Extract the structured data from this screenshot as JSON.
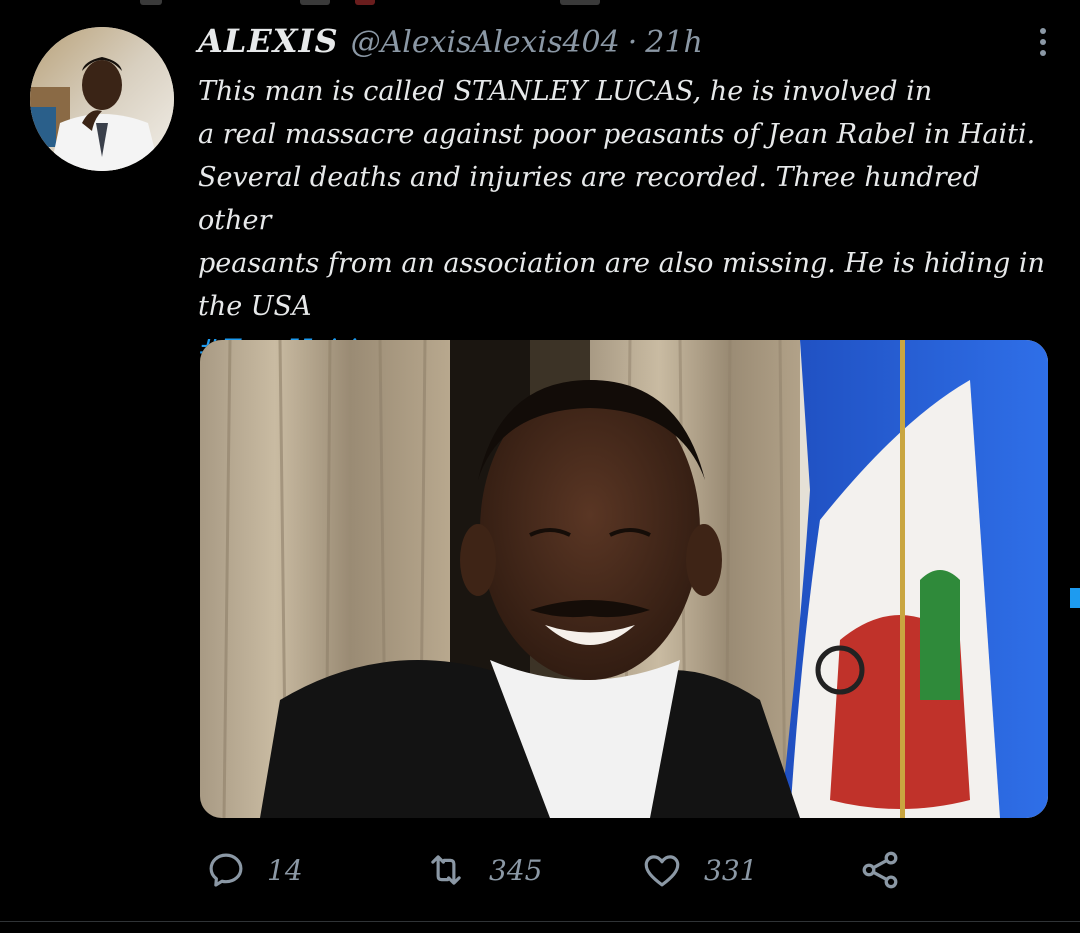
{
  "tweet": {
    "author_name": "ALEXIS",
    "handle": "@AlexisAlexis404",
    "separator": "·",
    "time": "21h",
    "body": "This man is called STANLEY LUCAS, he is involved in\na real massacre against poor peasants of Jean Rabel in Haiti.\nSeveral deaths and injuries are recorded. Three hundred other\npeasants from an association are also missing. He is hiding in\nthe USA",
    "hashtag": "#FreeHaiti"
  },
  "actions": {
    "reply_count": "14",
    "retweet_count": "345",
    "like_count": "331"
  },
  "icons": {
    "reply": "reply-icon",
    "retweet": "retweet-icon",
    "like": "heart-icon",
    "share": "share-icon",
    "more": "more-vertical-icon"
  },
  "colors": {
    "background": "#000000",
    "text": "#e7e9ea",
    "secondary": "#8b98a5",
    "link": "#1d9bf0"
  }
}
